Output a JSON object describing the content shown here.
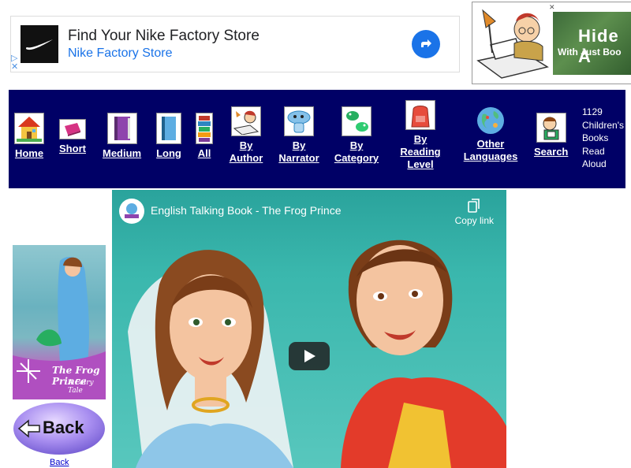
{
  "ad": {
    "title": "Find Your Nike Factory Store",
    "subtitle": "Nike Factory Store",
    "cta_icon": "arrow-right-icon",
    "brand_color": "#1a73e8"
  },
  "banner": {
    "headline": "Hide A",
    "subline": "With Just Boo"
  },
  "nav": {
    "items": [
      {
        "label": "Home",
        "icon": "house-icon"
      },
      {
        "label": "Short",
        "icon": "pink-book-icon"
      },
      {
        "label": "Medium",
        "icon": "purple-book-icon"
      },
      {
        "label": "Long",
        "icon": "blue-book-icon"
      },
      {
        "label": "All",
        "icon": "book-stack-icon"
      },
      {
        "label": "By Author",
        "icon": "author-writing-icon"
      },
      {
        "label": "By Narrator",
        "icon": "narrator-icon"
      },
      {
        "label": "By Category",
        "icon": "category-animals-icon"
      },
      {
        "label": "By Reading Level",
        "icon": "backpack-icon"
      },
      {
        "label": "Other Languages",
        "icon": "globe-icon"
      },
      {
        "label": "Search",
        "icon": "search-reader-icon"
      }
    ],
    "stats": "1129 Children's Books Read Aloud",
    "background": "#000066"
  },
  "video": {
    "title": "English Talking Book - The Frog Prince",
    "copy_link": "Copy link",
    "channel_icon": "channel-logo-icon",
    "play_icon": "play-icon"
  },
  "sidebar": {
    "cover_title": "The Frog Prince",
    "cover_subtitle": "A Fairy Tale",
    "back_button_text": "Back",
    "back_link": "Back"
  }
}
